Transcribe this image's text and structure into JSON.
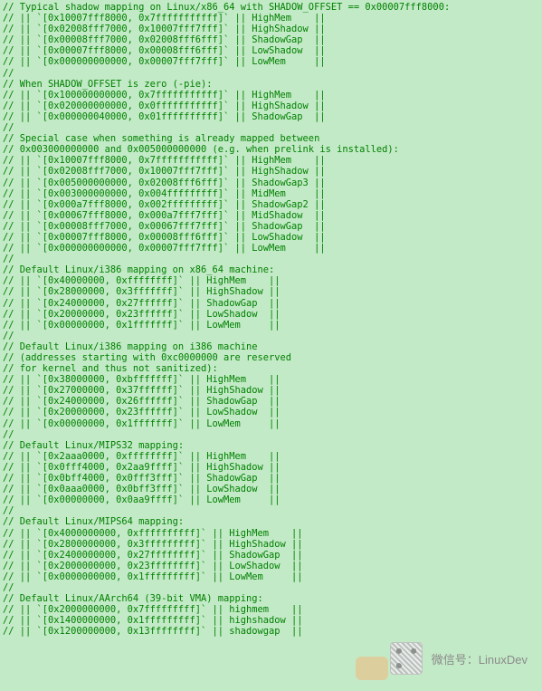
{
  "watermark": {
    "label": "微信号：",
    "handle": "LinuxDev"
  },
  "code": {
    "lines": [
      "// Typical shadow mapping on Linux/x86_64 with SHADOW_OFFSET == 0x00007fff8000:",
      "// || `[0x10007fff8000, 0x7fffffffffff]` || HighMem    ||",
      "// || `[0x02008fff7000, 0x10007fff7fff]` || HighShadow ||",
      "// || `[0x00008fff7000, 0x02008fff6fff]` || ShadowGap  ||",
      "// || `[0x00007fff8000, 0x00008fff6fff]` || LowShadow  ||",
      "// || `[0x000000000000, 0x00007fff7fff]` || LowMem     ||",
      "//",
      "// When SHADOW_OFFSET is zero (-pie):",
      "// || `[0x100000000000, 0x7fffffffffff]` || HighMem    ||",
      "// || `[0x020000000000, 0x0fffffffffff]` || HighShadow ||",
      "// || `[0x000000040000, 0x01ffffffffff]` || ShadowGap  ||",
      "//",
      "// Special case when something is already mapped between",
      "// 0x003000000000 and 0x005000000000 (e.g. when prelink is installed):",
      "// || `[0x10007fff8000, 0x7fffffffffff]` || HighMem    ||",
      "// || `[0x02008fff7000, 0x10007fff7fff]` || HighShadow ||",
      "// || `[0x005000000000, 0x02008fff6fff]` || ShadowGap3 ||",
      "// || `[0x003000000000, 0x004fffffffff]` || MidMem     ||",
      "// || `[0x000a7fff8000, 0x002fffffffff]` || ShadowGap2 ||",
      "// || `[0x00067fff8000, 0x000a7fff7fff]` || MidShadow  ||",
      "// || `[0x00008fff7000, 0x00067fff7fff]` || ShadowGap  ||",
      "// || `[0x00007fff8000, 0x00008fff6fff]` || LowShadow  ||",
      "// || `[0x000000000000, 0x00007fff7fff]` || LowMem     ||",
      "//",
      "// Default Linux/i386 mapping on x86_64 machine:",
      "// || `[0x40000000, 0xffffffff]` || HighMem    ||",
      "// || `[0x28000000, 0x3fffffff]` || HighShadow ||",
      "// || `[0x24000000, 0x27ffffff]` || ShadowGap  ||",
      "// || `[0x20000000, 0x23ffffff]` || LowShadow  ||",
      "// || `[0x00000000, 0x1fffffff]` || LowMem     ||",
      "//",
      "// Default Linux/i386 mapping on i386 machine",
      "// (addresses starting with 0xc0000000 are reserved",
      "// for kernel and thus not sanitized):",
      "// || `[0x38000000, 0xbfffffff]` || HighMem    ||",
      "// || `[0x27000000, 0x37ffffff]` || HighShadow ||",
      "// || `[0x24000000, 0x26ffffff]` || ShadowGap  ||",
      "// || `[0x20000000, 0x23ffffff]` || LowShadow  ||",
      "// || `[0x00000000, 0x1fffffff]` || LowMem     ||",
      "//",
      "// Default Linux/MIPS32 mapping:",
      "// || `[0x2aaa0000, 0xffffffff]` || HighMem    ||",
      "// || `[0x0fff4000, 0x2aa9ffff]` || HighShadow ||",
      "// || `[0x0bff4000, 0x0fff3fff]` || ShadowGap  ||",
      "// || `[0x0aaa0000, 0x0bff3fff]` || LowShadow  ||",
      "// || `[0x00000000, 0x0aa9ffff]` || LowMem     ||",
      "//",
      "// Default Linux/MIPS64 mapping:",
      "// || `[0x4000000000, 0xffffffffff]` || HighMem    ||",
      "// || `[0x2800000000, 0x3fffffffff]` || HighShadow ||",
      "// || `[0x2400000000, 0x27ffffffff]` || ShadowGap  ||",
      "// || `[0x2000000000, 0x23ffffffff]` || LowShadow  ||",
      "// || `[0x0000000000, 0x1fffffffff]` || LowMem     ||",
      "//",
      "// Default Linux/AArch64 (39-bit VMA) mapping:",
      "// || `[0x2000000000, 0x7fffffffff]` || highmem    ||",
      "// || `[0x1400000000, 0x1fffffffff]` || highshadow ||",
      "// || `[0x1200000000, 0x13ffffffff]` || shadowgap  ||"
    ]
  }
}
